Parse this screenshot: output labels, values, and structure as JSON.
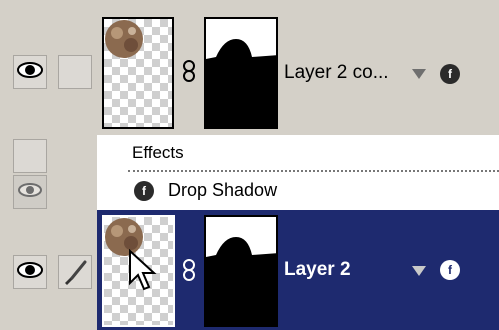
{
  "layers_panel": {
    "layers": [
      {
        "name": "Layer 2 co...",
        "selected": false,
        "has_brush": false
      },
      {
        "name": "Layer 2",
        "selected": true,
        "has_brush": true
      }
    ],
    "effects": {
      "header": "Effects",
      "items": [
        {
          "name": "Drop Shadow"
        }
      ]
    }
  },
  "icons": {
    "visibility": "eye-icon",
    "link": "chain-link-icon",
    "effects": "fx-icon",
    "paint": "brush-icon",
    "cursor": "mouse-pointer-icon"
  },
  "colors": {
    "panel_bg": "#d4d0c8",
    "selected_row": "#1e2a6f",
    "selected_text": "#ffffff",
    "text": "#000000"
  }
}
